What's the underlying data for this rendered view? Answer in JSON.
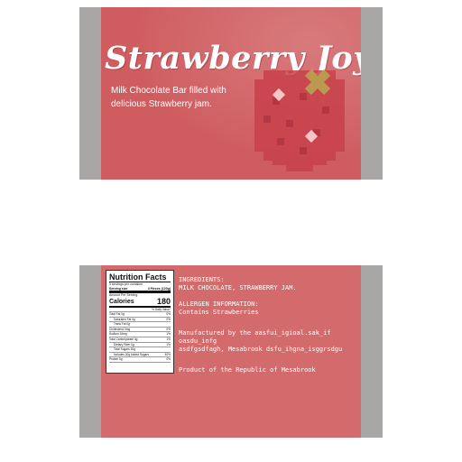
{
  "front": {
    "title": "Strawberry Joy",
    "tagline_line1": "Milk Chocolate Bar filled with",
    "tagline_line2": "delicious Strawberry jam."
  },
  "nutrition": {
    "title": "Nutrition Facts",
    "servings": "3 servings per container",
    "serving_size_label": "Serving size",
    "serving_size_value": "3 Pieces (120g)",
    "amount_per_serving": "Amount Per Serving",
    "calories_label": "Calories",
    "calories_value": "180",
    "daily_value_header": "% Daily Value*",
    "rows": [
      {
        "label": "Total Fat 0g",
        "value": "0%",
        "indent": false
      },
      {
        "label": "Saturated Fat 0g",
        "value": "0%",
        "indent": true
      },
      {
        "label": "Trans Fat 0g",
        "value": "",
        "indent": true
      },
      {
        "label": "Cholesterol 0mg",
        "value": "0%",
        "indent": false
      },
      {
        "label": "Sodium 15mg",
        "value": "1%",
        "indent": false
      },
      {
        "label": "Total Carbohydrate 4g",
        "value": "1%",
        "indent": false
      },
      {
        "label": "Dietary Fiber 0g",
        "value": "1%",
        "indent": true
      },
      {
        "label": "Total Sugars 30g",
        "value": "",
        "indent": true
      },
      {
        "label": "Includes 20g Added Sugars",
        "value": "40%",
        "indent": true
      },
      {
        "label": "Protein 0g",
        "value": "0%",
        "indent": false
      }
    ]
  },
  "back": {
    "ingredients_heading": "INGREDIENTS:",
    "ingredients_text": "MILK CHOCOLATE, STRAWBERRY JAM.",
    "allergen_heading": "ALLERGEN INFORMATION:",
    "allergen_text": "Contains Strawberries",
    "manufactured_line1": "Manufactured by the aasfui_igioal.sak_if",
    "manufactured_line2": "oasdu_infg",
    "manufactured_line3": "asdfgsdfagh, Mesabrook dsfu_ihgna_isggrsdgu",
    "origin": "Product of the Republic of Mesabrook"
  },
  "colors": {
    "wrapper_red": "#cf5d60",
    "border_gray": "#a9a7a6",
    "text_white": "#ffffff",
    "leaf_gold": "#b9a44e"
  },
  "icons": [
    "pixel-strawberry-icon"
  ]
}
